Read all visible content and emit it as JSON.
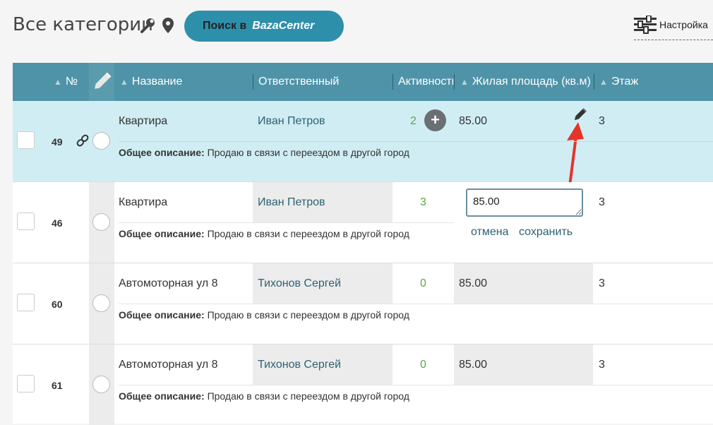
{
  "header": {
    "title": "Все категории",
    "search_prefix": "Поиск в",
    "search_brand": "BazaCenter",
    "settings_label": "Настройка"
  },
  "table": {
    "columns": {
      "num": "№",
      "name": "Название",
      "responsible": "Ответственный",
      "activity": "Активность",
      "area": "Жилая площадь (кв.м)",
      "floor": "Этаж"
    },
    "desc_label": "Общее описание:",
    "rows": [
      {
        "id": "49",
        "name": "Квартира",
        "responsible": "Иван Петров",
        "activity": "2",
        "area": "85.00",
        "floor": "3",
        "desc": "Продаю в связи с переездом в другой город"
      },
      {
        "id": "46",
        "name": "Квартира",
        "responsible": "Иван Петров",
        "activity": "3",
        "area": "85.00",
        "floor": "3",
        "desc": "Продаю в связи с переездом в другой город"
      },
      {
        "id": "60",
        "name": "Автомоторная ул 8",
        "responsible": "Тихонов Сергей",
        "activity": "0",
        "area": "85.00",
        "floor": "3",
        "desc": "Продаю в связи с переездом в другой город"
      },
      {
        "id": "61",
        "name": "Автомоторная ул 8",
        "responsible": "Тихонов Сергей",
        "activity": "0",
        "area": "85.00",
        "floor": "3",
        "desc": "Продаю в связи с переездом в другой город"
      }
    ],
    "edit": {
      "input_value": "85.00",
      "cancel_label": "отмена",
      "save_label": "сохранить"
    }
  },
  "colors": {
    "header_bg": "#4e93a8",
    "search_button": "#2e8fab",
    "active_row": "#d0edf4",
    "activity_green": "#5ba843",
    "arrow_red": "#e5332a"
  }
}
